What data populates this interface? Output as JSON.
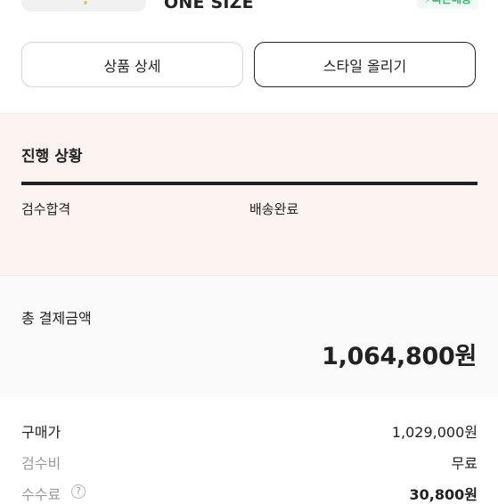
{
  "product": {
    "size": "ONE SIZE",
    "fast_delivery_badge": "⚡빠른배송"
  },
  "actions": {
    "detail_label": "상품 상세",
    "style_label": "스타일 올리기"
  },
  "progress": {
    "title": "진행 상황",
    "steps": [
      "검수합격",
      "배송완료"
    ],
    "completed_fraction": 1.0
  },
  "payment": {
    "total_label": "총 결제금액",
    "total_value": "1,064,800원",
    "rows": [
      {
        "label": "구매가",
        "value": "1,029,000원"
      },
      {
        "label": "검수비",
        "value": "무료"
      },
      {
        "label": "수수료",
        "value": "30,800원"
      }
    ],
    "help_glyph": "?"
  },
  "colors": {
    "progress_bg": "#fdf4f1",
    "fast_delivery": "#31b46e",
    "progress_bar": "#222222"
  }
}
